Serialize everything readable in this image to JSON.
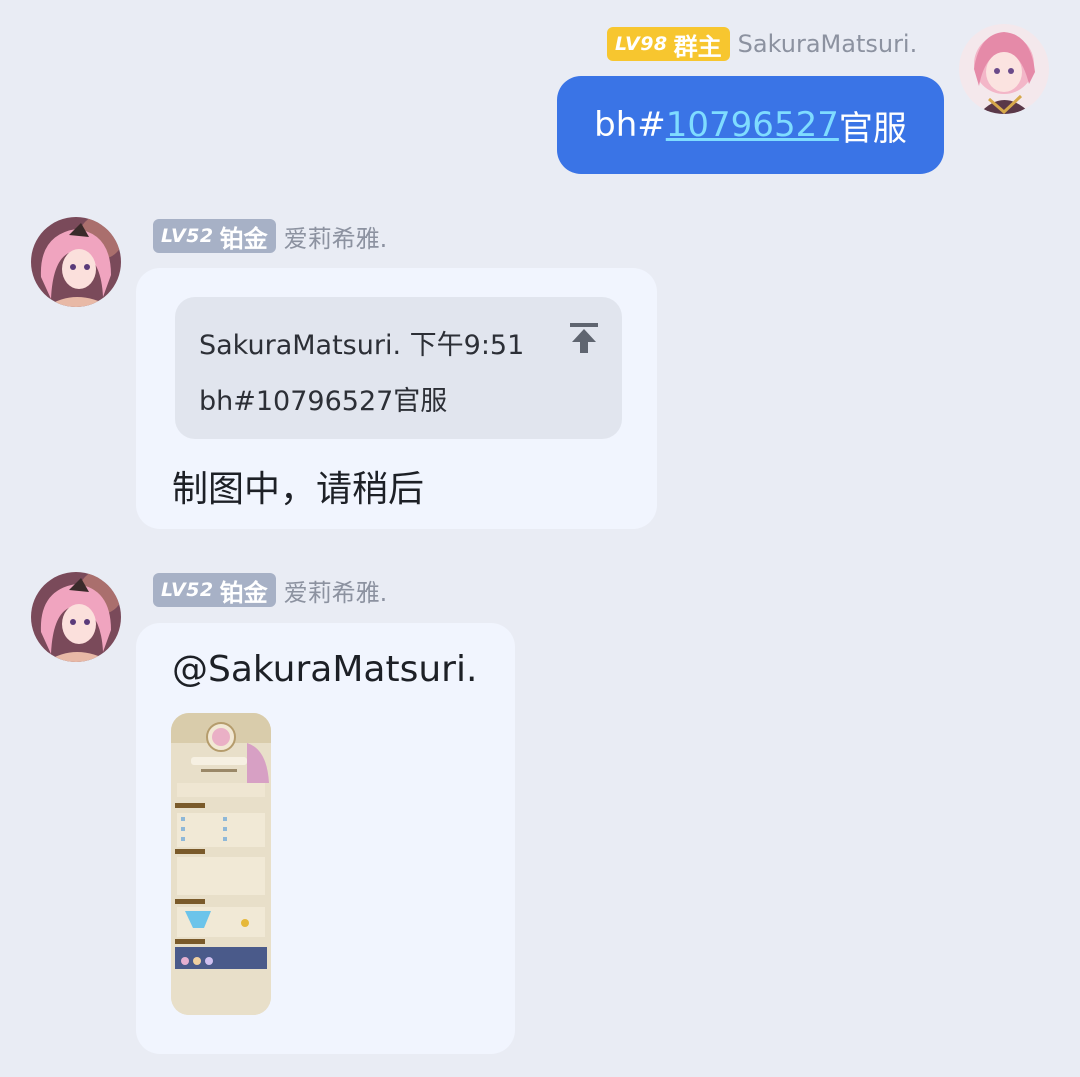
{
  "messages": [
    {
      "id": "m1",
      "side": "right",
      "sender": {
        "level": "LV98",
        "role": "群主",
        "name": "SakuraMatsuri."
      },
      "text_prefix": "bh#",
      "text_link": "10796527",
      "text_suffix": "官服"
    },
    {
      "id": "m2",
      "side": "left",
      "sender": {
        "level": "LV52",
        "role": "铂金",
        "name": "爱莉希雅."
      },
      "quote": {
        "author": "SakuraMatsuri.",
        "time": "下午9:51",
        "text": "bh#10796527官服",
        "icon": "jump-to-original-icon"
      },
      "text": "制图中，请稍后"
    },
    {
      "id": "m3",
      "side": "left",
      "sender": {
        "level": "LV52",
        "role": "铂金",
        "name": "爱莉希雅."
      },
      "text": "@SakuraMatsuri.",
      "image": "game-stats-card-thumbnail"
    }
  ],
  "colors": {
    "background": "#e9ecf4",
    "sent_bubble": "#3a74e6",
    "received_bubble": "#f1f5fe",
    "link": "#7fdcff",
    "owner_badge": "#f7c62f",
    "platinum_badge": "#a7b1c6"
  }
}
